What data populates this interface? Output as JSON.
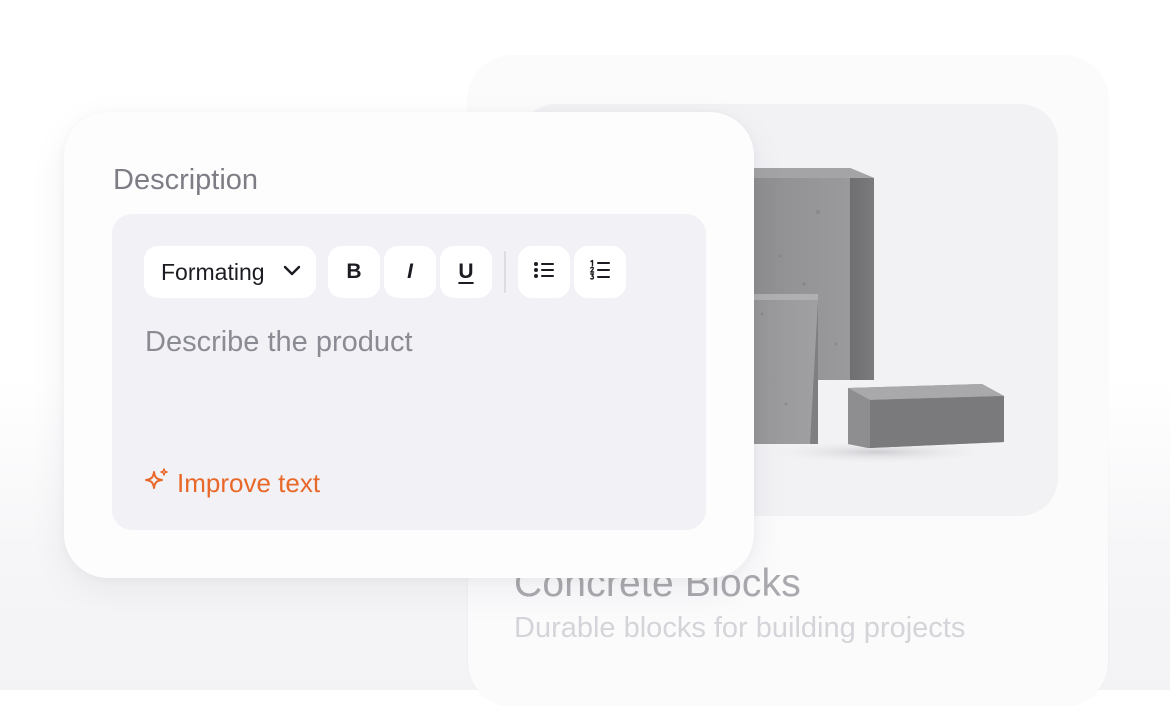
{
  "product_card": {
    "title": "Concrete Blocks",
    "subtitle": "Durable blocks for building projects",
    "image": "concrete-blocks-render"
  },
  "description_panel": {
    "label": "Description",
    "toolbar": {
      "formatting_label": "Formating",
      "formatting_icon": "chevron-down-icon",
      "bold_glyph": "B",
      "italic_glyph": "I",
      "underline_glyph": "U",
      "bullet_icon": "bulleted-list-icon",
      "number_icon": "numbered-list-icon"
    },
    "editor": {
      "value": "",
      "placeholder": "Describe the product"
    },
    "improve_text_label": "Improve text",
    "improve_icon": "sparkle-icon"
  },
  "colors": {
    "accent": "#e8682a",
    "panel_bg": "#fdfdfe",
    "editor_bg": "#f2f2f6",
    "text_muted": "#7d7d85"
  }
}
